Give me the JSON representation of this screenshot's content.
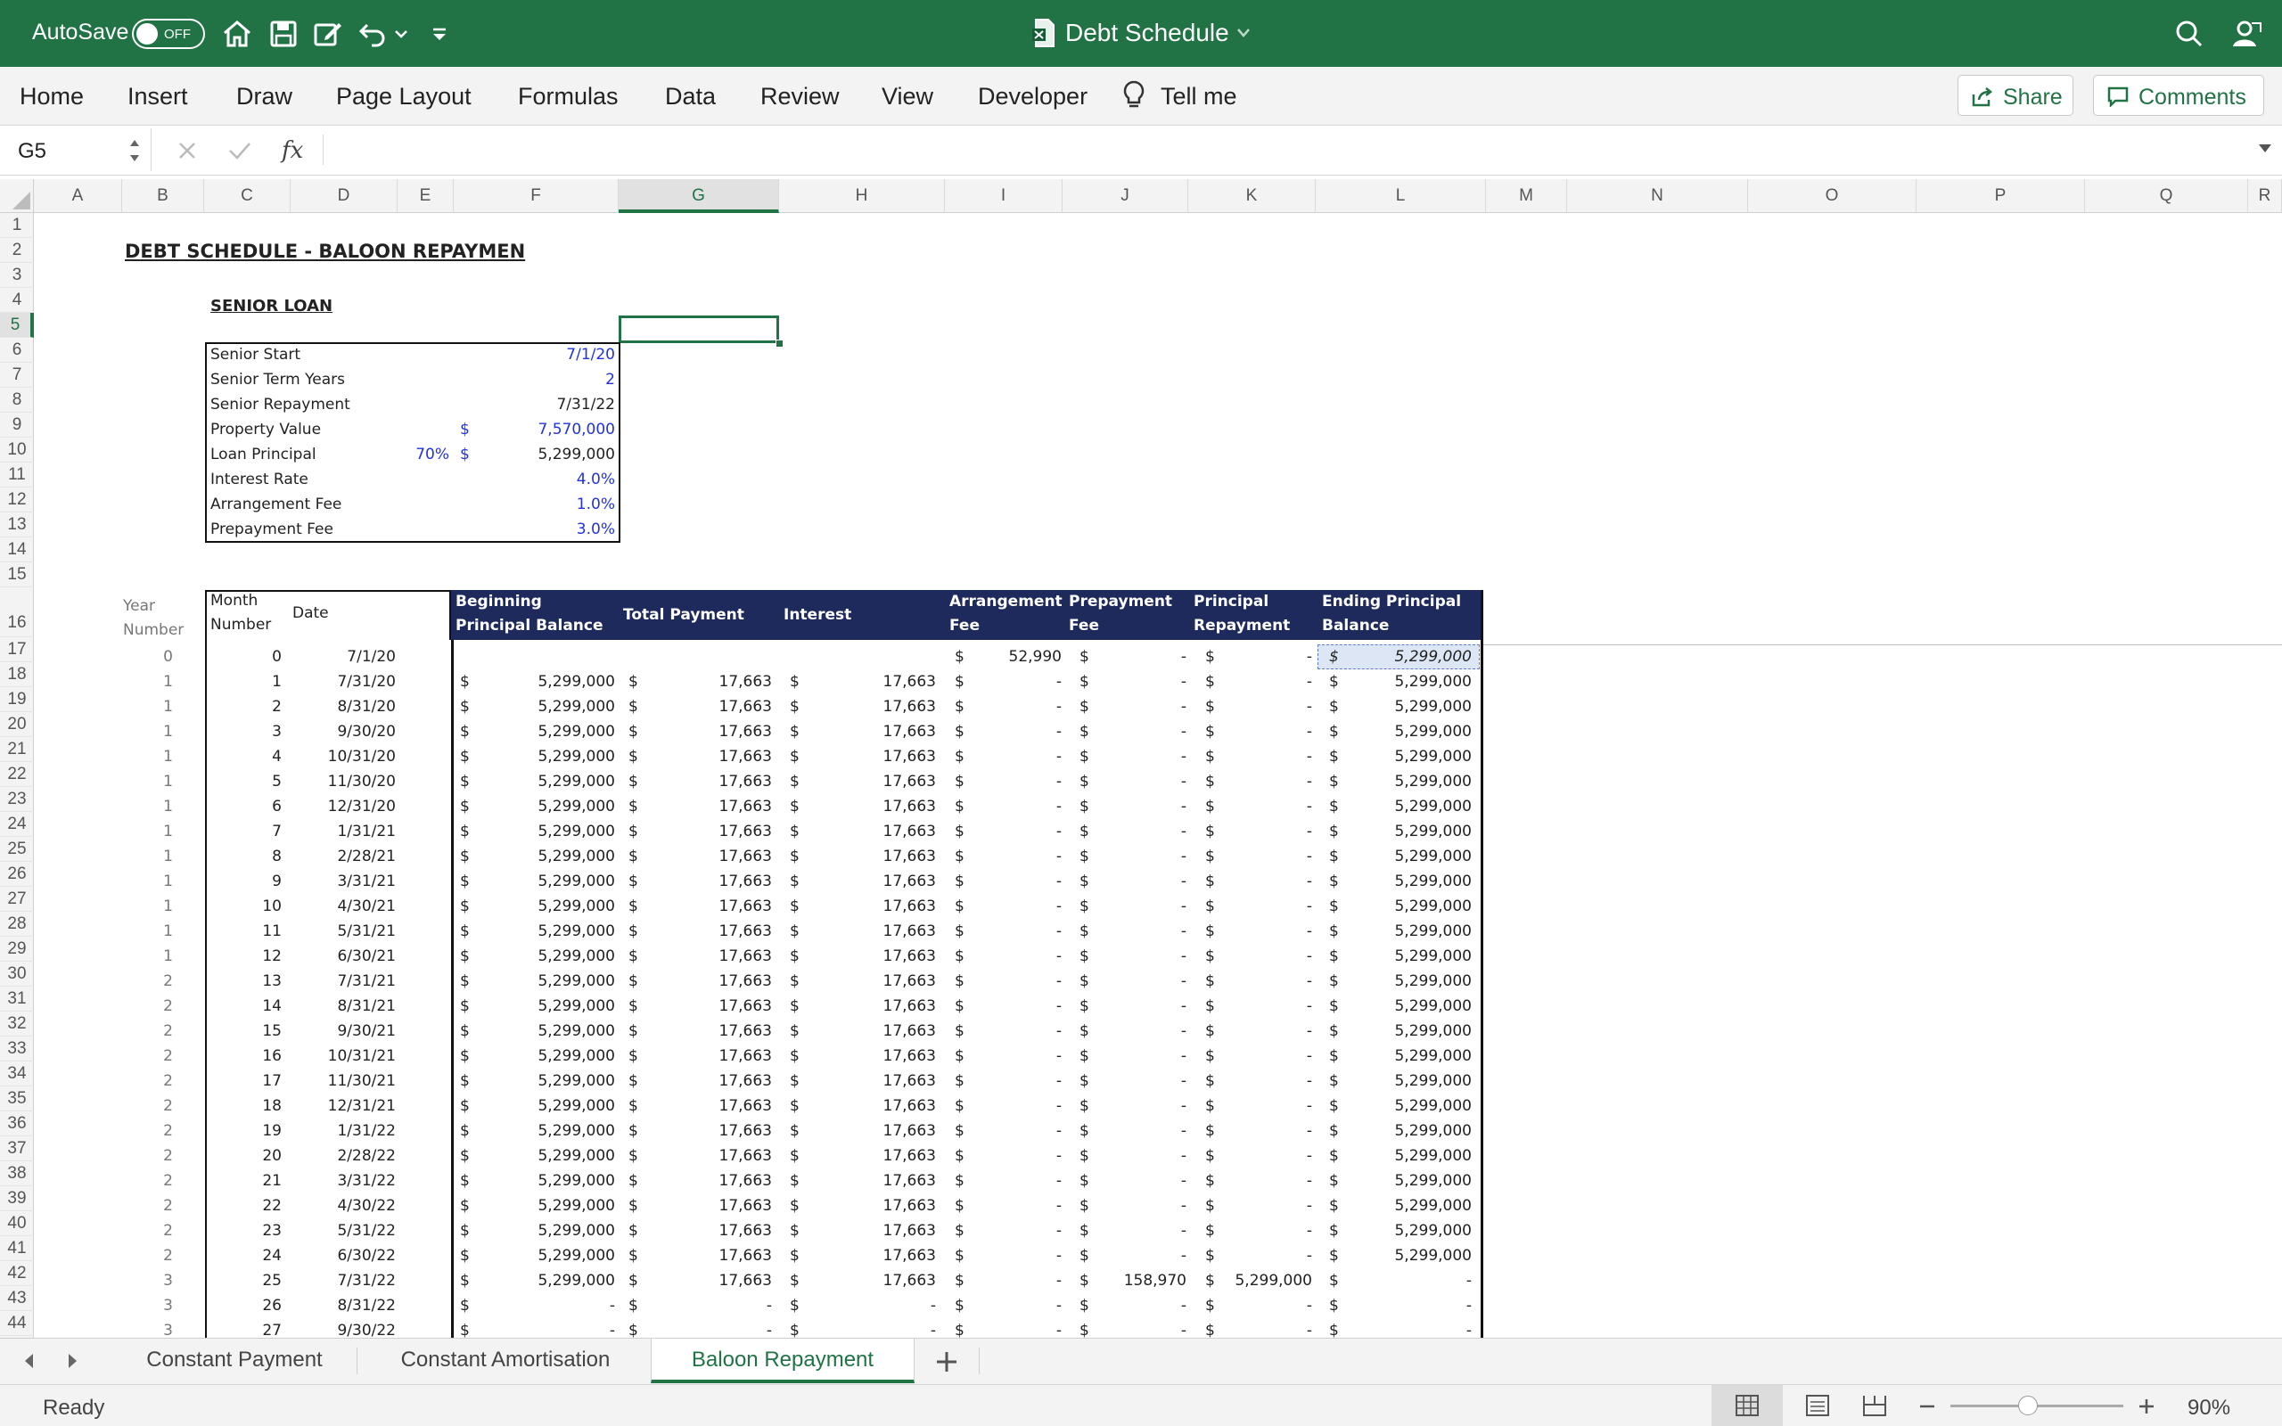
{
  "titlebar": {
    "autosave": "AutoSave",
    "toggle": "OFF",
    "doc_title": "Debt Schedule"
  },
  "ribbon": {
    "tabs": [
      "Home",
      "Insert",
      "Draw",
      "Page Layout",
      "Formulas",
      "Data",
      "Review",
      "View",
      "Developer"
    ],
    "tell_me": "Tell me",
    "share": "Share",
    "comments": "Comments"
  },
  "formula_bar": {
    "name_box": "G5",
    "formula": ""
  },
  "columns": [
    "A",
    "B",
    "C",
    "D",
    "E",
    "F",
    "G",
    "H",
    "I",
    "J",
    "K",
    "L",
    "M",
    "N",
    "O",
    "P",
    "Q",
    "R"
  ],
  "rows": [
    "1",
    "2",
    "3",
    "4",
    "5",
    "6",
    "7",
    "8",
    "9",
    "10",
    "11",
    "12",
    "13",
    "14",
    "15",
    "16",
    "17",
    "18",
    "19",
    "20",
    "21",
    "22",
    "23",
    "24",
    "25",
    "26",
    "27",
    "28",
    "29",
    "30",
    "31",
    "32",
    "33",
    "34",
    "35",
    "36",
    "37",
    "38",
    "39",
    "40",
    "41",
    "42",
    "43",
    "44"
  ],
  "sheet": {
    "title": "DEBT SCHEDULE - BALOON REPAYMEN",
    "section": "SENIOR LOAN",
    "inputs": [
      {
        "label": "Senior Start",
        "pct": "",
        "cur": "",
        "value": "7/1/20",
        "blue": true
      },
      {
        "label": "Senior Term Years",
        "pct": "",
        "cur": "",
        "value": "2",
        "blue": true
      },
      {
        "label": "Senior Repayment",
        "pct": "",
        "cur": "",
        "value": "7/31/22",
        "blue": false
      },
      {
        "label": "Property Value",
        "pct": "",
        "cur": "$",
        "value": "7,570,000",
        "blue": true
      },
      {
        "label": "Loan Principal",
        "pct": "70%",
        "cur": "$",
        "value": "5,299,000",
        "blue": false
      },
      {
        "label": "Interest Rate",
        "pct": "",
        "cur": "",
        "value": "4.0%",
        "blue": true
      },
      {
        "label": "Arrangement Fee",
        "pct": "",
        "cur": "",
        "value": "1.0%",
        "blue": true
      },
      {
        "label": "Prepayment Fee",
        "pct": "",
        "cur": "",
        "value": "3.0%",
        "blue": true
      }
    ],
    "header_left": {
      "year": "Year",
      "number": "Number",
      "month": "Month",
      "month2": "Number",
      "date": "Date"
    },
    "table_headers": [
      "Beginning Principal Balance",
      "Total Payment",
      "Interest",
      "Arrangement Fee",
      "Prepayment Fee",
      "Principal Repayment",
      "Ending Principal Balance"
    ],
    "currency_symbol": "$",
    "schedule": [
      [
        "0",
        "0",
        "7/1/20",
        "",
        "",
        "",
        "52,990",
        "-",
        "-",
        "5,299,000"
      ],
      [
        "1",
        "1",
        "7/31/20",
        "5,299,000",
        "17,663",
        "17,663",
        "-",
        "-",
        "-",
        "5,299,000"
      ],
      [
        "1",
        "2",
        "8/31/20",
        "5,299,000",
        "17,663",
        "17,663",
        "-",
        "-",
        "-",
        "5,299,000"
      ],
      [
        "1",
        "3",
        "9/30/20",
        "5,299,000",
        "17,663",
        "17,663",
        "-",
        "-",
        "-",
        "5,299,000"
      ],
      [
        "1",
        "4",
        "10/31/20",
        "5,299,000",
        "17,663",
        "17,663",
        "-",
        "-",
        "-",
        "5,299,000"
      ],
      [
        "1",
        "5",
        "11/30/20",
        "5,299,000",
        "17,663",
        "17,663",
        "-",
        "-",
        "-",
        "5,299,000"
      ],
      [
        "1",
        "6",
        "12/31/20",
        "5,299,000",
        "17,663",
        "17,663",
        "-",
        "-",
        "-",
        "5,299,000"
      ],
      [
        "1",
        "7",
        "1/31/21",
        "5,299,000",
        "17,663",
        "17,663",
        "-",
        "-",
        "-",
        "5,299,000"
      ],
      [
        "1",
        "8",
        "2/28/21",
        "5,299,000",
        "17,663",
        "17,663",
        "-",
        "-",
        "-",
        "5,299,000"
      ],
      [
        "1",
        "9",
        "3/31/21",
        "5,299,000",
        "17,663",
        "17,663",
        "-",
        "-",
        "-",
        "5,299,000"
      ],
      [
        "1",
        "10",
        "4/30/21",
        "5,299,000",
        "17,663",
        "17,663",
        "-",
        "-",
        "-",
        "5,299,000"
      ],
      [
        "1",
        "11",
        "5/31/21",
        "5,299,000",
        "17,663",
        "17,663",
        "-",
        "-",
        "-",
        "5,299,000"
      ],
      [
        "1",
        "12",
        "6/30/21",
        "5,299,000",
        "17,663",
        "17,663",
        "-",
        "-",
        "-",
        "5,299,000"
      ],
      [
        "2",
        "13",
        "7/31/21",
        "5,299,000",
        "17,663",
        "17,663",
        "-",
        "-",
        "-",
        "5,299,000"
      ],
      [
        "2",
        "14",
        "8/31/21",
        "5,299,000",
        "17,663",
        "17,663",
        "-",
        "-",
        "-",
        "5,299,000"
      ],
      [
        "2",
        "15",
        "9/30/21",
        "5,299,000",
        "17,663",
        "17,663",
        "-",
        "-",
        "-",
        "5,299,000"
      ],
      [
        "2",
        "16",
        "10/31/21",
        "5,299,000",
        "17,663",
        "17,663",
        "-",
        "-",
        "-",
        "5,299,000"
      ],
      [
        "2",
        "17",
        "11/30/21",
        "5,299,000",
        "17,663",
        "17,663",
        "-",
        "-",
        "-",
        "5,299,000"
      ],
      [
        "2",
        "18",
        "12/31/21",
        "5,299,000",
        "17,663",
        "17,663",
        "-",
        "-",
        "-",
        "5,299,000"
      ],
      [
        "2",
        "19",
        "1/31/22",
        "5,299,000",
        "17,663",
        "17,663",
        "-",
        "-",
        "-",
        "5,299,000"
      ],
      [
        "2",
        "20",
        "2/28/22",
        "5,299,000",
        "17,663",
        "17,663",
        "-",
        "-",
        "-",
        "5,299,000"
      ],
      [
        "2",
        "21",
        "3/31/22",
        "5,299,000",
        "17,663",
        "17,663",
        "-",
        "-",
        "-",
        "5,299,000"
      ],
      [
        "2",
        "22",
        "4/30/22",
        "5,299,000",
        "17,663",
        "17,663",
        "-",
        "-",
        "-",
        "5,299,000"
      ],
      [
        "2",
        "23",
        "5/31/22",
        "5,299,000",
        "17,663",
        "17,663",
        "-",
        "-",
        "-",
        "5,299,000"
      ],
      [
        "2",
        "24",
        "6/30/22",
        "5,299,000",
        "17,663",
        "17,663",
        "-",
        "-",
        "-",
        "5,299,000"
      ],
      [
        "3",
        "25",
        "7/31/22",
        "5,299,000",
        "17,663",
        "17,663",
        "-",
        "158,970",
        "5,299,000",
        "-"
      ],
      [
        "3",
        "26",
        "8/31/22",
        "-",
        "-",
        "-",
        "-",
        "-",
        "-",
        "-"
      ],
      [
        "3",
        "27",
        "9/30/22",
        "-",
        "-",
        "-",
        "-",
        "-",
        "-",
        "-"
      ]
    ]
  },
  "sheet_tabs": [
    "Constant Payment",
    "Constant Amortisation",
    "Baloon Repayment"
  ],
  "status": {
    "ready": "Ready",
    "zoom": "90%",
    "zoom_level": 0.45
  },
  "colors": {
    "excel_green": "#217346",
    "header_navy": "#1f2a5c",
    "input_blue": "#2233dd"
  }
}
